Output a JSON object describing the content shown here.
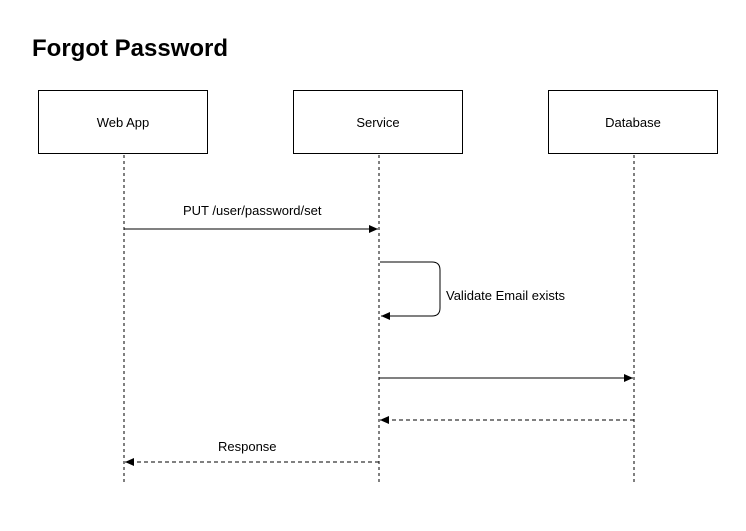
{
  "title": "Forgot Password",
  "participants": [
    {
      "name": "Web App"
    },
    {
      "name": "Service"
    },
    {
      "name": "Database"
    }
  ],
  "messages": [
    {
      "from": "Web App",
      "to": "Service",
      "label": "PUT /user/password/set",
      "style": "solid"
    },
    {
      "from": "Service",
      "to": "Service",
      "label": "Validate Email exists",
      "style": "solid"
    },
    {
      "from": "Service",
      "to": "Database",
      "label": "",
      "style": "solid"
    },
    {
      "from": "Database",
      "to": "Service",
      "label": "",
      "style": "dashed"
    },
    {
      "from": "Service",
      "to": "Web App",
      "label": "Response",
      "style": "dashed"
    }
  ]
}
